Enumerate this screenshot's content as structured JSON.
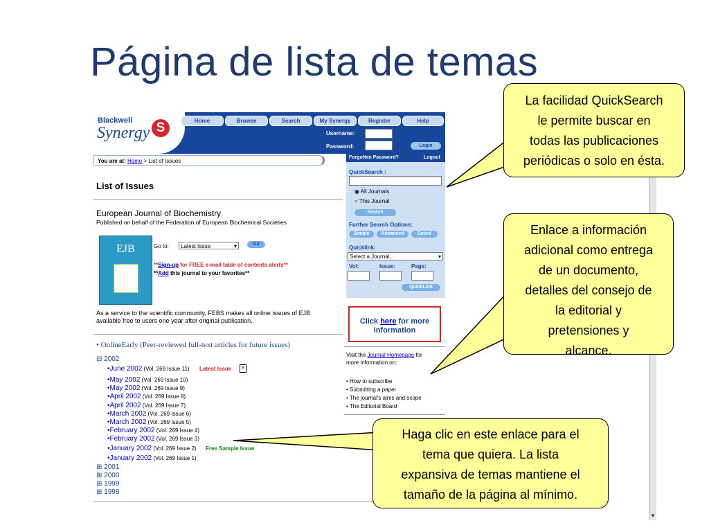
{
  "slide_title": "Página de lista de temas",
  "logo": {
    "line1": "Blackwell",
    "line2": "Synergy",
    "symbol": "S"
  },
  "nav": [
    "Home",
    "Browse",
    "Search",
    "My Synergy",
    "Register",
    "Help"
  ],
  "login": {
    "username_label": "Username:",
    "password_label": "Password:",
    "button": "Login"
  },
  "breadcrumb": {
    "prefix": "You are at:",
    "home": "Home",
    "sep": " > ",
    "current": "List of Issues"
  },
  "side": {
    "forgotten": "Forgotten Password?",
    "logout": "Logout",
    "quicksearch": "QuickSearch :",
    "all_journals": "All Journals",
    "this_journal": "This Journal",
    "search_btn": "Search",
    "further": "Further Search Options:",
    "opt_simple": "Simple",
    "opt_advanced": "Advanced",
    "opt_saved": "Saved",
    "quicklink": "Quicklink:",
    "select_journal": "Select a Journal...",
    "vol": "Vol:",
    "issue": "Issue:",
    "page": "Page:",
    "quicklink_btn": "QuickLink"
  },
  "main": {
    "list_title": "List of Issues",
    "journal": "European Journal of Biochemistry",
    "published": "Published on behalf of the Federation of European Biochemical Societies",
    "cover_text": "EJB",
    "goto": "Go to:",
    "goto_select": "Latest Issue",
    "go_btn": "Go",
    "signup_pre": "**",
    "signup_link": "Sign-up",
    "signup_post": " for FREE e-mail table of contents alerts**",
    "add_pre": "**",
    "add_link": "Add",
    "add_post": " this journal to your favorites**",
    "service1": "As a service to the scientific community, FEBS makes all online issues of EJB",
    "service2": "available free to users one year after original publication.",
    "online_early": "• OnlineEarly (Peer-reviewed full-text articles for future issues)",
    "year_open": "2002",
    "issues": [
      {
        "label": "•June 2002",
        "vol": " (Vol. 269 Issue 11)"
      },
      {
        "label": "•May 2002",
        "vol": " (Vol. 269 Issue 10)"
      },
      {
        "label": "•May 2002",
        "vol": " (Vol. 269 Issue 9)"
      },
      {
        "label": "•April 2002",
        "vol": " (Vol. 269 Issue 8)"
      },
      {
        "label": "•April 2002",
        "vol": " (Vol. 269 Issue 7)"
      },
      {
        "label": "•March 2002",
        "vol": " (Vol. 269 Issue 6)"
      },
      {
        "label": "•March 2002",
        "vol": " (Vol. 269 Issue 5)"
      },
      {
        "label": "•February 2002",
        "vol": " (Vol. 269 Issue 4)"
      },
      {
        "label": "•February 2002",
        "vol": " (Vol. 269 Issue 3)"
      },
      {
        "label": "•January 2002",
        "vol": " (Vol. 269 Issue 2)"
      },
      {
        "label": "•January 2002",
        "vol": " (Vol. 269 Issue 1)"
      }
    ],
    "latest_issue": "Latest Issue",
    "free_sample": "Free Sample Issue",
    "years": [
      "2001",
      "2000",
      "1999",
      "1998"
    ]
  },
  "info": {
    "click_pre": "Click ",
    "click_link": "here",
    "click_post": " for more",
    "click_line2": "information",
    "visit_pre": "Visit the ",
    "visit_link": "Journal Homepage",
    "visit_post": " for",
    "visit_line2": "more information on:",
    "bullets": [
      "• How to subscribe",
      "• Submitting a paper",
      "• The journal's aims and scope",
      "• The Editorial Board"
    ]
  },
  "callouts": {
    "c1": [
      "La facilidad QuickSearch",
      "le permite buscar en",
      "todas las publicaciones",
      "periódicas o solo en ésta."
    ],
    "c2": [
      "Enlace a información",
      "adicional como entrega",
      "de un documento,",
      "detalles del consejo de",
      "la editorial y",
      "pretensiones y",
      "alcance."
    ],
    "c3": [
      "Haga clic en este enlace para el",
      "tema que quiera. La lista",
      "expansiva de temas mantiene el",
      "tamaño de la página al mínimo."
    ]
  },
  "colors": {
    "brand_blue": "#16479a",
    "callout_yellow": "#ffff99",
    "red": "#d9252a"
  }
}
